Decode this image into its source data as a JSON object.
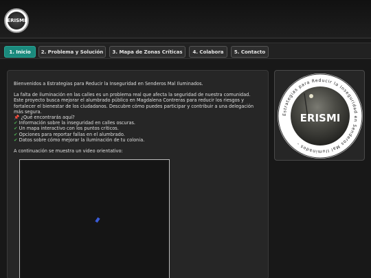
{
  "header": {
    "logo_text": "ERISMI"
  },
  "nav": {
    "tabs": [
      {
        "label": "1. Inicio",
        "active": true
      },
      {
        "label": "2. Problema y Solución",
        "active": false
      },
      {
        "label": "3. Mapa de Zonas Críticas",
        "active": false
      },
      {
        "label": "4. Colabora",
        "active": false
      },
      {
        "label": "5. Contacto",
        "active": false
      }
    ]
  },
  "main": {
    "welcome": "Bienvenidos a Estrategias para Reducir la Inseguridad en Senderos Mal Iluminados.",
    "intro_lines": [
      "La falta de iluminación en las calles es un problema real que afecta la seguridad de nuestra comunidad.",
      "Este proyecto busca mejorar el alumbrado público en Magdalena Contreras para reducir los riesgos y",
      "fortalecer el bienestar de los ciudadanos. Descubre cómo puedes participar y contribuir a una delegación",
      "más segura."
    ],
    "question": "¿Qué encontrarás aquí?",
    "list": [
      "Información sobre la inseguridad en calles oscuras.",
      "Un mapa interactivo con los puntos críticos.",
      "Opciones para reportar fallas en el alumbrado.",
      "Datos sobre cómo mejorar la iluminación de tu colonia."
    ],
    "video_intro": "A continuación se muestra un video orientativo:"
  },
  "side": {
    "seal_center_text": "ERISMI",
    "seal_ring_text": "Estrategias para Reducir la Inseguridad en Senderos Mal Iluminados -"
  },
  "colors": {
    "accent": "#1b8a7d",
    "check": "#4caf50",
    "background": "#181818"
  }
}
